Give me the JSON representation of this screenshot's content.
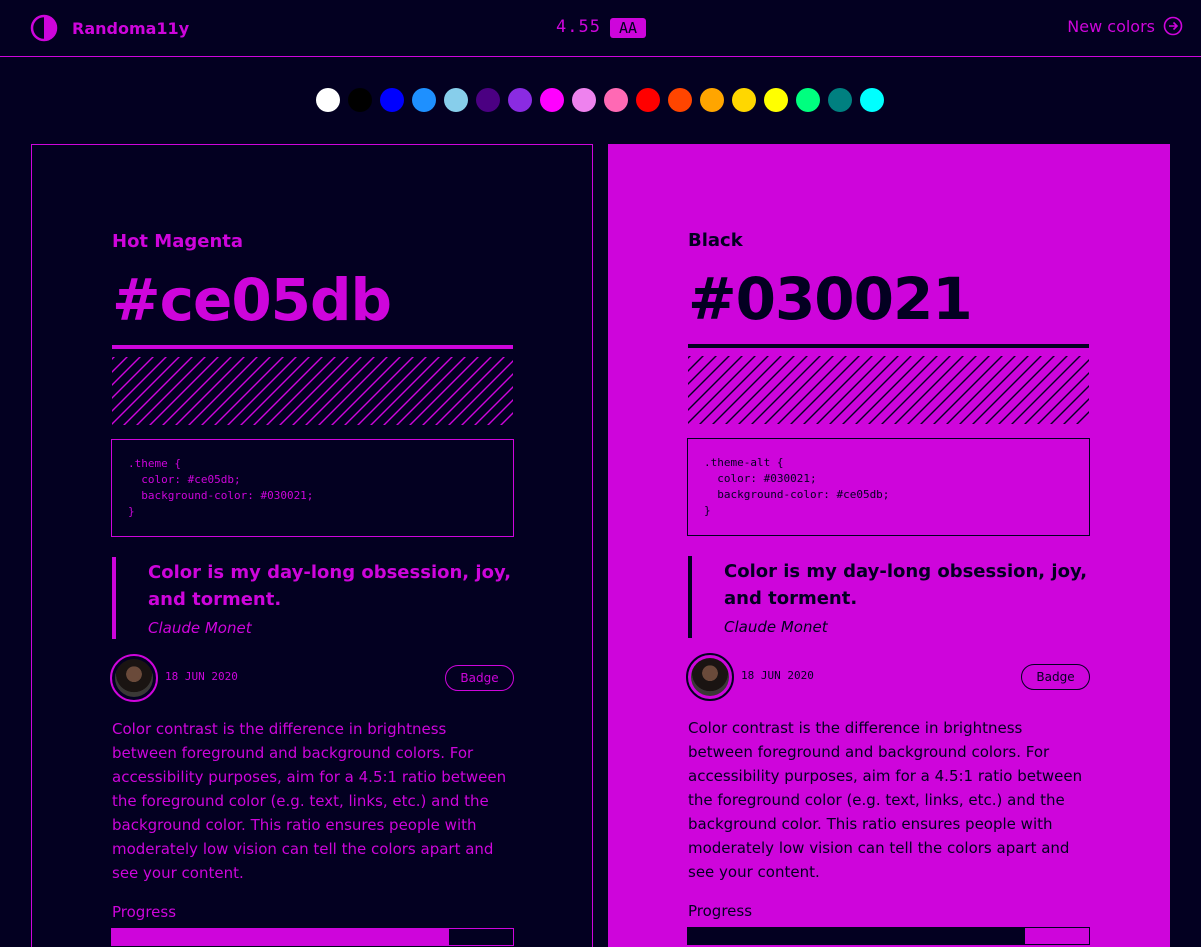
{
  "header": {
    "app_title": "Randoma11y",
    "contrast_ratio": "4.55",
    "rating": "AA",
    "new_colors_label": "New colors"
  },
  "swatches": [
    "#ffffff",
    "#000000",
    "#0000ff",
    "#1e90ff",
    "#87ceeb",
    "#4b0082",
    "#8a2be2",
    "#ff00ff",
    "#ee82ee",
    "#ff69b4",
    "#ff0000",
    "#ff4500",
    "#ffa500",
    "#ffd700",
    "#ffff00",
    "#00ff7f",
    "#008080",
    "#00ffff"
  ],
  "panels": [
    {
      "color_name": "Hot Magenta",
      "hex": "#ce05db",
      "code": ".theme {\n  color: #ce05db;\n  background-color: #030021;\n}",
      "quote": "Color is my day-long obsession, joy, and torment.",
      "author": "Claude Monet",
      "date": "18 JUN 2020",
      "badge": "Badge",
      "body": "Color contrast is the difference in brightness between foreground and background colors. For accessibility purposes, aim for a 4.5:1 ratio between the foreground color (e.g. text, links, etc.) and the background color. This ratio ensures people with moderately low vision can tell the colors apart and see your content.",
      "progress_label": "Progress",
      "progress": 0.84
    },
    {
      "color_name": "Black",
      "hex": "#030021",
      "code": ".theme-alt {\n  color: #030021;\n  background-color: #ce05db;\n}",
      "quote": "Color is my day-long obsession, joy, and torment.",
      "author": "Claude Monet",
      "date": "18 JUN 2020",
      "badge": "Badge",
      "body": "Color contrast is the difference in brightness between foreground and background colors. For accessibility purposes, aim for a 4.5:1 ratio between the foreground color (e.g. text, links, etc.) and the background color. This ratio ensures people with moderately low vision can tell the colors apart and see your content.",
      "progress_label": "Progress",
      "progress": 0.84
    }
  ],
  "colors": {
    "foreground": "#ce05db",
    "background": "#030021"
  },
  "icons": {
    "logo": "contrast-half-circle-icon",
    "new_colors": "arrow-right-circle-icon"
  }
}
